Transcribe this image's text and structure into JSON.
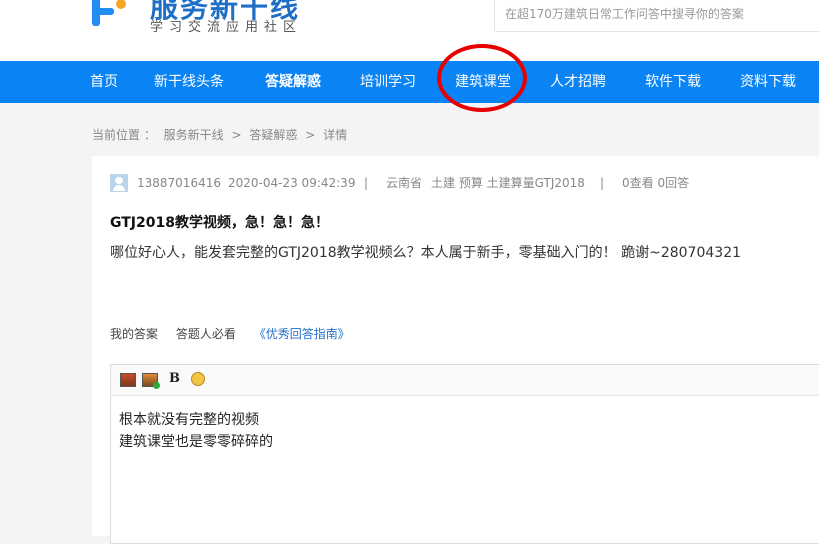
{
  "header": {
    "logo_title": "服务新干线",
    "logo_subtitle": "学习交流应用社区",
    "search_placeholder": "在超170万建筑日常工作问答中搜寻你的答案"
  },
  "nav": {
    "items": [
      {
        "label": "首页"
      },
      {
        "label": "新干线头条"
      },
      {
        "label": "答疑解惑",
        "active": true
      },
      {
        "label": "培训学习"
      },
      {
        "label": "建筑课堂",
        "highlighted": true
      },
      {
        "label": "人才招聘"
      },
      {
        "label": "软件下载"
      },
      {
        "label": "资料下载"
      }
    ]
  },
  "breadcrumb": {
    "prefix": "当前位置 ：",
    "items": [
      "服务新干线",
      "答疑解惑",
      "详情"
    ],
    "separator": ">"
  },
  "question": {
    "user": "13887016416",
    "datetime": "2020-04-23 09:42:39",
    "sep": "|",
    "location": "云南省",
    "tags": "土建 预算 土建算量GTJ2018",
    "stats": "0查看 0回答",
    "title": "GTJ2018教学视频，急！急！急！",
    "body": "哪位好心人，能发套完整的GTJ2018教学视频么？本人属于新手，零基础入门的！ 跪谢~280704321"
  },
  "answer": {
    "tab_mine": "我的答案",
    "tab_required": "答题人必看",
    "guide_link": "《优秀回答指南》",
    "bold_label": "B",
    "lines": [
      "根本就没有完整的视频",
      "建筑课堂也是零零碎碎的"
    ]
  },
  "colors": {
    "nav_bg": "#0a84f5",
    "highlight_circle": "#e80000",
    "link": "#1f6fc6"
  }
}
